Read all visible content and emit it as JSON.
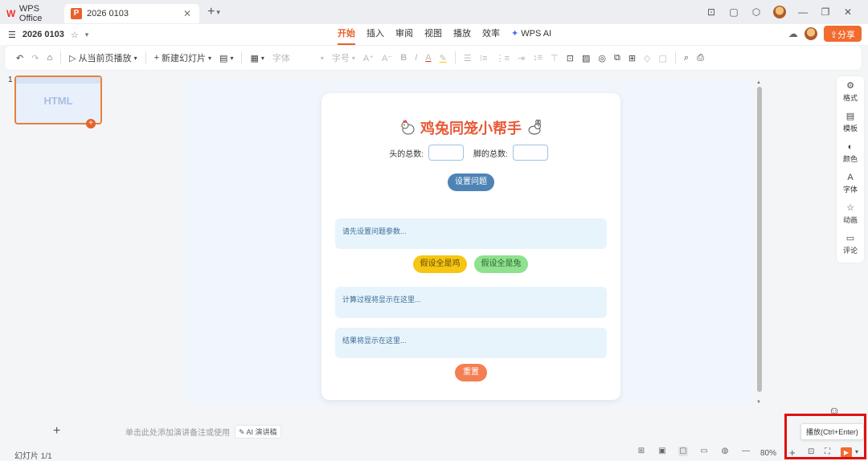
{
  "titlebar": {
    "app_tab": "WPS Office",
    "doc_tab": "2026 0103"
  },
  "menu": {
    "doc_name": "2026 0103",
    "tabs": [
      "开始",
      "插入",
      "审阅",
      "视图",
      "播放",
      "效率",
      "WPS AI"
    ],
    "active_tab": "开始",
    "share": "分享"
  },
  "toolbar": {
    "play_from_current": "从当前页播放",
    "new_slide": "新建幻灯片",
    "font": "字体",
    "font_size": "字号"
  },
  "slides": {
    "number": "1",
    "thumb_label": "HTML"
  },
  "app": {
    "title": "鸡兔同笼小帮手",
    "heads_label": "头的总数:",
    "feet_label": "脚的总数:",
    "setup_button": "设置问题",
    "hint": "请先设置问题参数...",
    "all_chicken_button": "假设全是鸡",
    "all_rabbit_button": "假设全是兔",
    "process_placeholder": "计算过程将显示在这里...",
    "result_placeholder": "结果将显示在这里...",
    "reset_button": "重置"
  },
  "rightpanel": {
    "items": [
      "格式",
      "模板",
      "颜色",
      "字体",
      "动画",
      "评论"
    ]
  },
  "notes": {
    "placeholder": "单击此处添加演讲备注或使用",
    "ai_label": "AI 演讲稿"
  },
  "status": {
    "slide_count": "幻灯片 1/1",
    "zoom": "80%"
  },
  "tooltip": {
    "text": "播放(Ctrl+Enter)"
  }
}
